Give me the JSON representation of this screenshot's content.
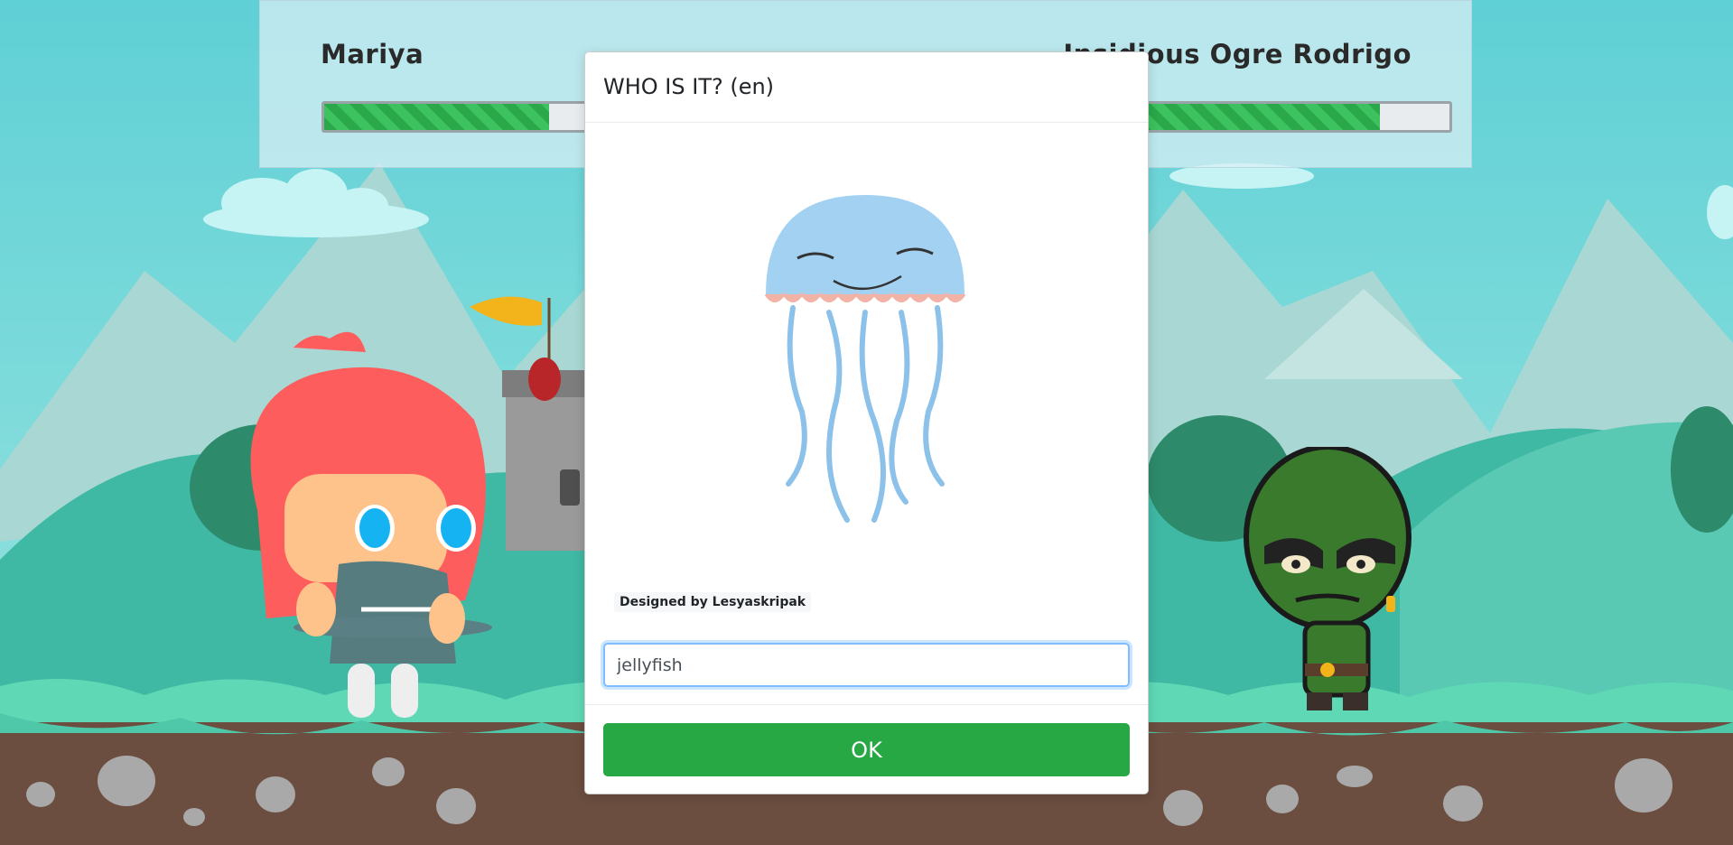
{
  "hud": {
    "player_name": "Mariya",
    "opponent_name": "Insidious Ogre Rodrigo",
    "player_hp_fraction": 0.58,
    "opponent_hp_fraction": 0.82
  },
  "modal": {
    "title": "WHO IS IT? (en)",
    "image_icon": "jellyfish-illustration",
    "credit": "Designed by Lesyaskripak",
    "answer_value": "jellyfish",
    "ok_label": "OK"
  },
  "colors": {
    "hp_green": "#2aa84a",
    "ok_button": "#28a745",
    "input_focus": "#80bdff"
  },
  "characters": {
    "player_icon": "red-haired-girl-character",
    "opponent_icon": "green-ogre-character"
  }
}
